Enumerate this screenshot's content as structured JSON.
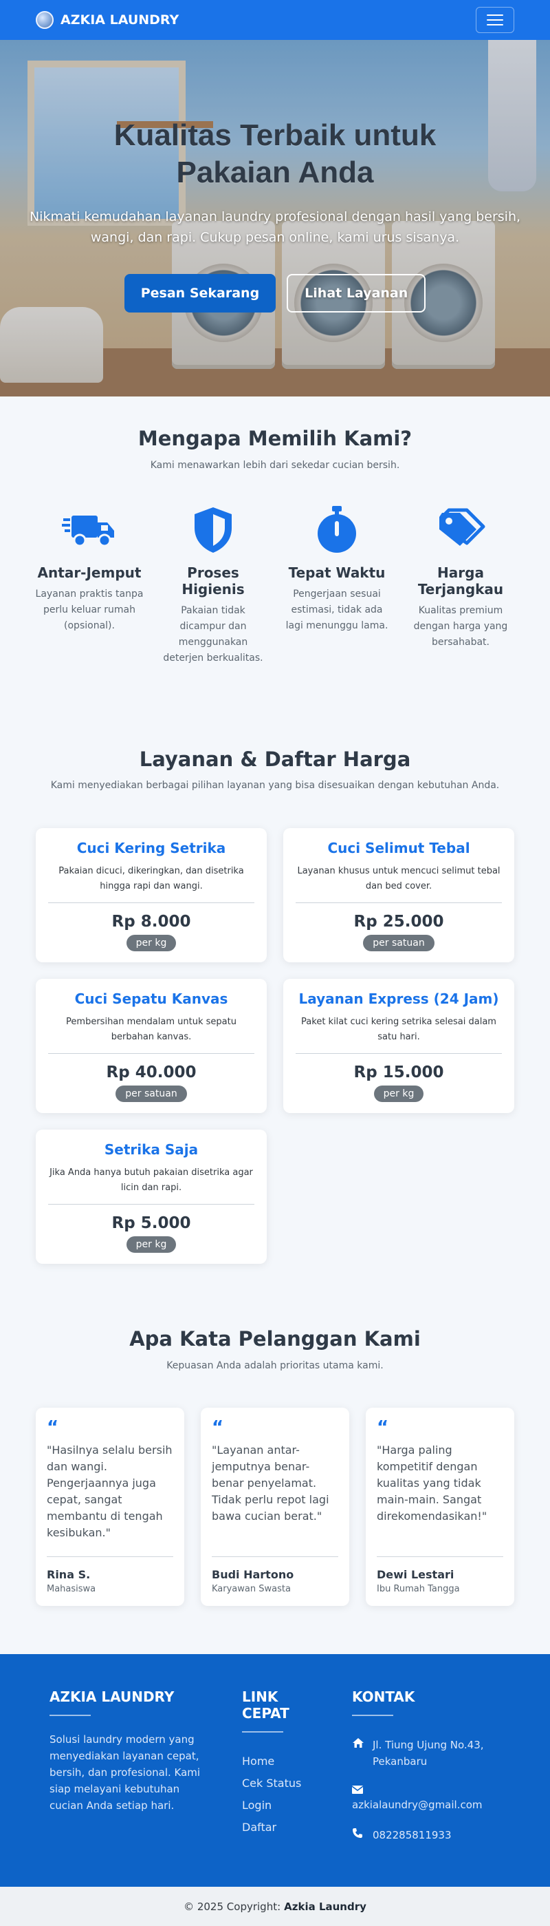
{
  "navbar": {
    "brand": "AZKIA LAUNDRY"
  },
  "hero": {
    "title": "Kualitas Terbaik untuk Pakaian Anda",
    "subtitle": "Nikmati kemudahan layanan laundry profesional dengan hasil yang bersih, wangi, dan rapi. Cukup pesan online, kami urus sisanya.",
    "primary_button": "Pesan Sekarang",
    "secondary_button": "Lihat Layanan"
  },
  "why": {
    "title": "Mengapa Memilih Kami?",
    "subtitle": "Kami menawarkan lebih dari sekedar cucian bersih.",
    "features": [
      {
        "icon": "truck-icon",
        "title": "Antar-Jemput",
        "desc": "Layanan praktis tanpa perlu keluar rumah (opsional)."
      },
      {
        "icon": "shield-icon",
        "title": "Proses Higienis",
        "desc": "Pakaian tidak dicampur dan menggunakan deterjen berkualitas."
      },
      {
        "icon": "stopwatch-icon",
        "title": "Tepat Waktu",
        "desc": "Pengerjaan sesuai estimasi, tidak ada lagi menunggu lama."
      },
      {
        "icon": "tags-icon",
        "title": "Harga Terjangkau",
        "desc": "Kualitas premium dengan harga yang bersahabat."
      }
    ]
  },
  "pricing": {
    "title": "Layanan & Daftar Harga",
    "subtitle": "Kami menyediakan berbagai pilihan layanan yang bisa disesuaikan dengan kebutuhan Anda.",
    "items": [
      {
        "name": "Cuci Kering Setrika",
        "desc": "Pakaian dicuci, dikeringkan, dan disetrika hingga rapi dan wangi.",
        "price": "Rp 8.000",
        "unit": "per kg"
      },
      {
        "name": "Cuci Selimut Tebal",
        "desc": "Layanan khusus untuk mencuci selimut tebal dan bed cover.",
        "price": "Rp 25.000",
        "unit": "per satuan"
      },
      {
        "name": "Cuci Sepatu Kanvas",
        "desc": "Pembersihan mendalam untuk sepatu berbahan kanvas.",
        "price": "Rp 40.000",
        "unit": "per satuan"
      },
      {
        "name": "Layanan Express (24 Jam)",
        "desc": "Paket kilat cuci kering setrika selesai dalam satu hari.",
        "price": "Rp 15.000",
        "unit": "per kg"
      },
      {
        "name": "Setrika Saja",
        "desc": "Jika Anda hanya butuh pakaian disetrika agar licin dan rapi.",
        "price": "Rp 5.000",
        "unit": "per kg"
      }
    ]
  },
  "testimonials": {
    "title": "Apa Kata Pelanggan Kami",
    "subtitle": "Kepuasan Anda adalah prioritas utama kami.",
    "quote_mark": "“",
    "items": [
      {
        "text": "\"Hasilnya selalu bersih dan wangi. Pengerjaannya juga cepat, sangat membantu di tengah kesibukan.\"",
        "name": "Rina S.",
        "role": "Mahasiswa"
      },
      {
        "text": "\"Layanan antar-jemputnya benar-benar penyelamat. Tidak perlu repot lagi bawa cucian berat.\"",
        "name": "Budi Hartono",
        "role": "Karyawan Swasta"
      },
      {
        "text": "\"Harga paling kompetitif dengan kualitas yang tidak main-main. Sangat direkomendasikan!\"",
        "name": "Dewi Lestari",
        "role": "Ibu Rumah Tangga"
      }
    ]
  },
  "footer": {
    "about_title": "AZKIA LAUNDRY",
    "about_text": "Solusi laundry modern yang menyediakan layanan cepat, bersih, dan profesional. Kami siap melayani kebutuhan cucian Anda setiap hari.",
    "links_title": "LINK CEPAT",
    "links": [
      "Home",
      "Cek Status",
      "Login",
      "Daftar"
    ],
    "contact_title": "KONTAK",
    "address": "Jl. Tiung Ujung No.43, Pekanbaru",
    "email": "azkialaundry@gmail.com",
    "phone": "082285811933"
  },
  "copyright": {
    "prefix": "© 2025 Copyright:",
    "brand": "Azkia Laundry"
  },
  "colors": {
    "primary": "#1a73e8",
    "footer": "#0d63c7",
    "muted_badge": "#6c757d"
  }
}
